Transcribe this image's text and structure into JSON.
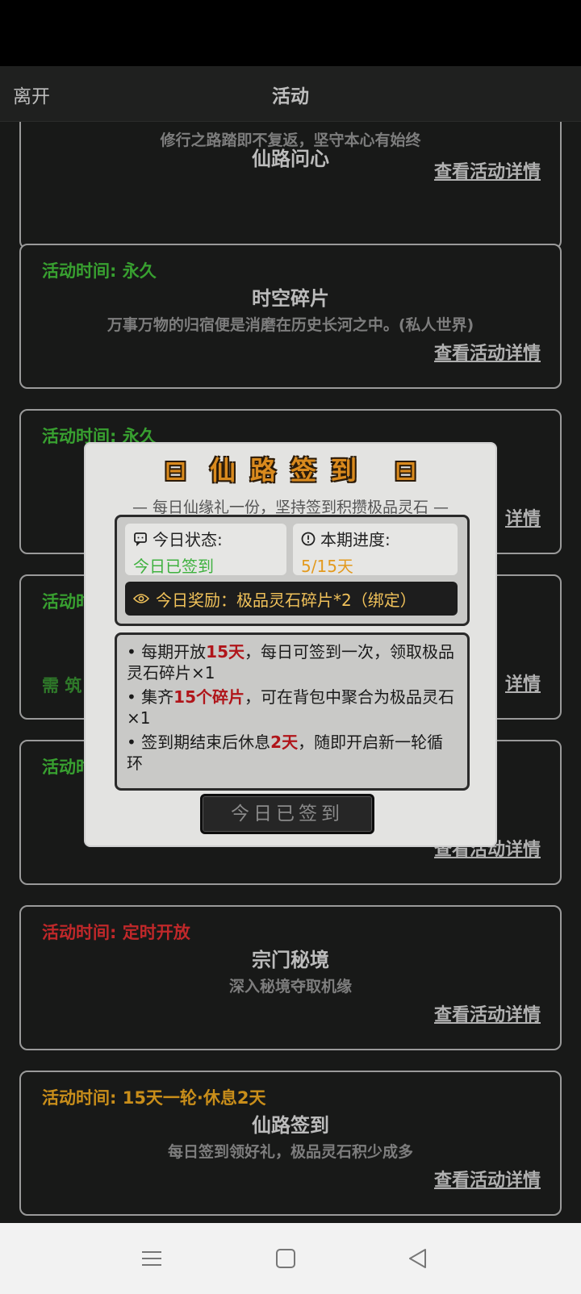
{
  "header": {
    "leave": "离开",
    "title": "活动"
  },
  "cards": [
    {
      "time": "",
      "time_color": "",
      "name": "仙路问心",
      "desc": "修行之路踏即不复返，坚守本心有始终",
      "detail": "查看活动详情"
    },
    {
      "time": "活动时间: 永久",
      "time_color": "#38a030",
      "name": "时空碎片",
      "desc": "万事万物的归宿便是消磨在历史长河之中。(私人世界)",
      "detail": "查看活动详情"
    },
    {
      "time": "活动时间: 永久",
      "time_color": "#38a030",
      "name": "",
      "desc": "",
      "detail": "详情"
    },
    {
      "time": "活动时",
      "time_color": "#38a030",
      "name": "",
      "desc": "",
      "detail": "详情",
      "req": "需 筑"
    },
    {
      "time": "活动时",
      "time_color": "#38a030",
      "name": "",
      "desc": "",
      "detail": "查看活动详情"
    },
    {
      "time": "活动时间: 定时开放",
      "time_color": "#c0282a",
      "name": "宗门秘境",
      "desc": "深入秘境夺取机缘",
      "detail": "查看活动详情"
    },
    {
      "time": "活动时间: 15天一轮·休息2天",
      "time_color": "#c98e1a",
      "name": "仙路签到",
      "desc": "每日签到领好礼，极品灵石积少成多",
      "detail": "查看活动详情"
    }
  ],
  "modal": {
    "title": "仙路签到",
    "subtitle": "— 每日仙缘礼一份，坚持签到积攒极品灵石 —",
    "status_label": "今日状态:",
    "status_value": "今日已签到",
    "progress_label": "本期进度:",
    "progress_value": "5/15天",
    "reward": "今日奖励：极品灵石碎片*2（绑定）",
    "rules": [
      {
        "pre": "• 每期开放",
        "hl": "15天",
        "post": "，每日可签到一次，领取极品灵石碎片×1"
      },
      {
        "pre": "• 集齐",
        "hl": "15个碎片",
        "post": "，可在背包中聚合为极品灵石×1"
      },
      {
        "pre": "• 签到期结束后休息",
        "hl": "2天",
        "post": "，随即开启新一轮循环"
      }
    ],
    "button": "今日已签到"
  },
  "colors": {
    "status_green": "#3fb13f",
    "progress_orange": "#e39a1e",
    "highlight_red": "#b0151a",
    "title_orange": "#d98a1e"
  },
  "navbar": {
    "icons": [
      "menu-icon",
      "home-square-icon",
      "back-triangle-icon"
    ]
  }
}
